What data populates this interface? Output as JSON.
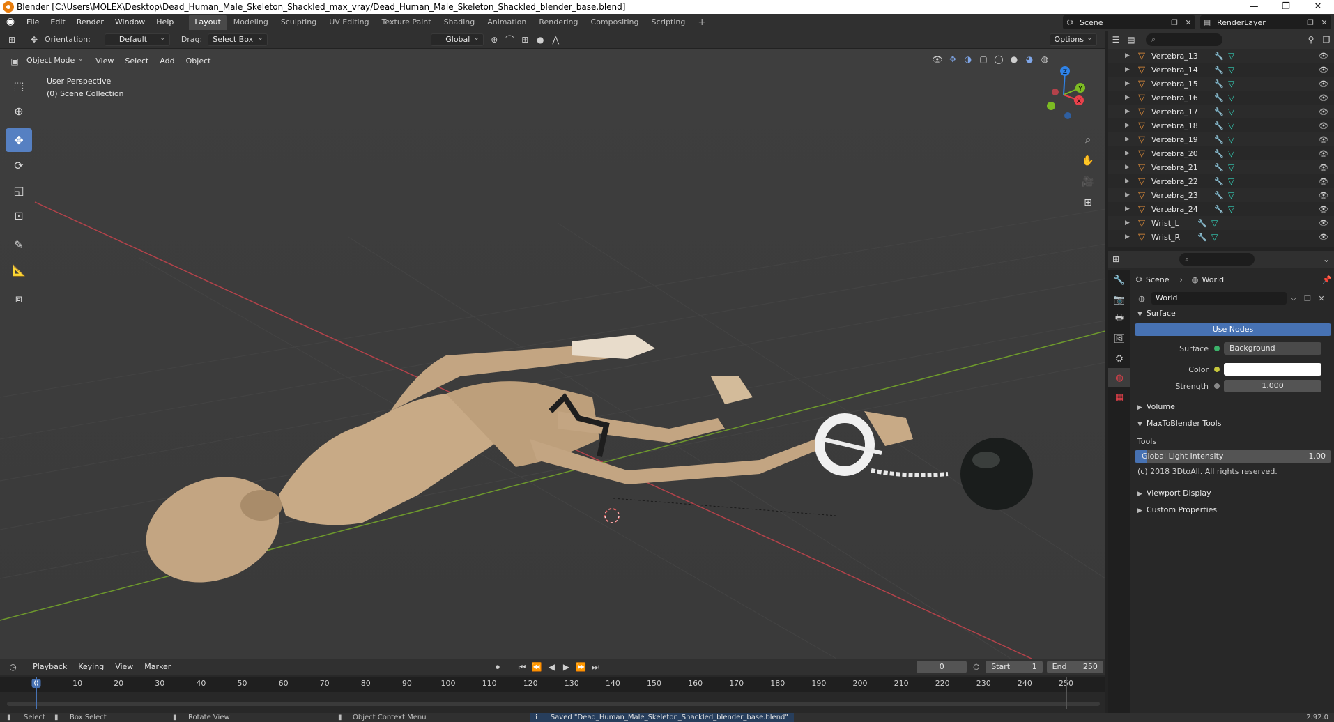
{
  "window": {
    "title": "Blender [C:\\Users\\MOLEX\\Desktop\\Dead_Human_Male_Skeleton_Shackled_max_vray/Dead_Human_Male_Skeleton_Shackled_blender_base.blend]",
    "minimize": "—",
    "restore": "❐",
    "close": "✕"
  },
  "menu": [
    "File",
    "Edit",
    "Render",
    "Window",
    "Help"
  ],
  "workspaces": [
    {
      "label": "Layout",
      "active": true
    },
    {
      "label": "Modeling"
    },
    {
      "label": "Sculpting"
    },
    {
      "label": "UV Editing"
    },
    {
      "label": "Texture Paint"
    },
    {
      "label": "Shading"
    },
    {
      "label": "Animation"
    },
    {
      "label": "Rendering"
    },
    {
      "label": "Compositing"
    },
    {
      "label": "Scripting"
    }
  ],
  "workspace_add": "+",
  "scene": {
    "name": "Scene"
  },
  "render_layer": {
    "name": "RenderLayer"
  },
  "viewport_header": {
    "orientation_label": "Orientation:",
    "orientation_value": "Default",
    "drag_label": "Drag:",
    "drag_value": "Select Box",
    "transform_orientation": "Global",
    "options": "Options"
  },
  "viewport_menu": {
    "mode": "Object Mode",
    "items": [
      "View",
      "Select",
      "Add",
      "Object"
    ]
  },
  "viewport_info": {
    "line1": "User Perspective",
    "line2": "(0) Scene Collection"
  },
  "gizmo": {
    "z": "Z",
    "y": "Y",
    "x": "X"
  },
  "colors": {
    "accent": "#4772b3",
    "object_orange": "#e8913a",
    "mesh_teal": "#34d0b8",
    "axis_x": "#e8414b",
    "axis_y": "#7cbb23",
    "axis_z": "#2f83e8"
  },
  "outliner": {
    "rows": [
      {
        "name": "Vertebra_13"
      },
      {
        "name": "Vertebra_14"
      },
      {
        "name": "Vertebra_15"
      },
      {
        "name": "Vertebra_16"
      },
      {
        "name": "Vertebra_17"
      },
      {
        "name": "Vertebra_18"
      },
      {
        "name": "Vertebra_19"
      },
      {
        "name": "Vertebra_20"
      },
      {
        "name": "Vertebra_21"
      },
      {
        "name": "Vertebra_22"
      },
      {
        "name": "Vertebra_23"
      },
      {
        "name": "Vertebra_24"
      },
      {
        "name": "Wrist_L"
      },
      {
        "name": "Wrist_R"
      }
    ]
  },
  "properties": {
    "crumb_scene": "Scene",
    "crumb_world": "World",
    "world_name": "World",
    "surface_panel": "Surface",
    "use_nodes": "Use Nodes",
    "surface_label": "Surface",
    "surface_value": "Background",
    "color_label": "Color",
    "strength_label": "Strength",
    "strength_value": "1.000",
    "volume_panel": "Volume",
    "max_panel": "MaxToBlender Tools",
    "tools_label": "Tools",
    "gli_label": "Global Light Intensity",
    "gli_value": "1.00",
    "gli_fill": 0.06,
    "copyright": "(c) 2018 3DtoAll. All rights reserved.",
    "viewport_display": "Viewport Display",
    "custom_props": "Custom Properties"
  },
  "timeline": {
    "menus": [
      "Playback",
      "Keying",
      "View",
      "Marker"
    ],
    "current_frame": "0",
    "start_label": "Start",
    "start_value": "1",
    "end_label": "End",
    "end_value": "250",
    "ticks": [
      "0",
      "10",
      "20",
      "30",
      "40",
      "50",
      "60",
      "70",
      "80",
      "90",
      "100",
      "110",
      "120",
      "130",
      "140",
      "150",
      "160",
      "170",
      "180",
      "190",
      "200",
      "210",
      "220",
      "230",
      "240",
      "250"
    ]
  },
  "status": {
    "select": "Select",
    "box_select": "Box Select",
    "rotate_view": "Rotate View",
    "context_menu": "Object Context Menu",
    "message": "Saved \"Dead_Human_Male_Skeleton_Shackled_blender_base.blend\"",
    "version": "2.92.0"
  }
}
